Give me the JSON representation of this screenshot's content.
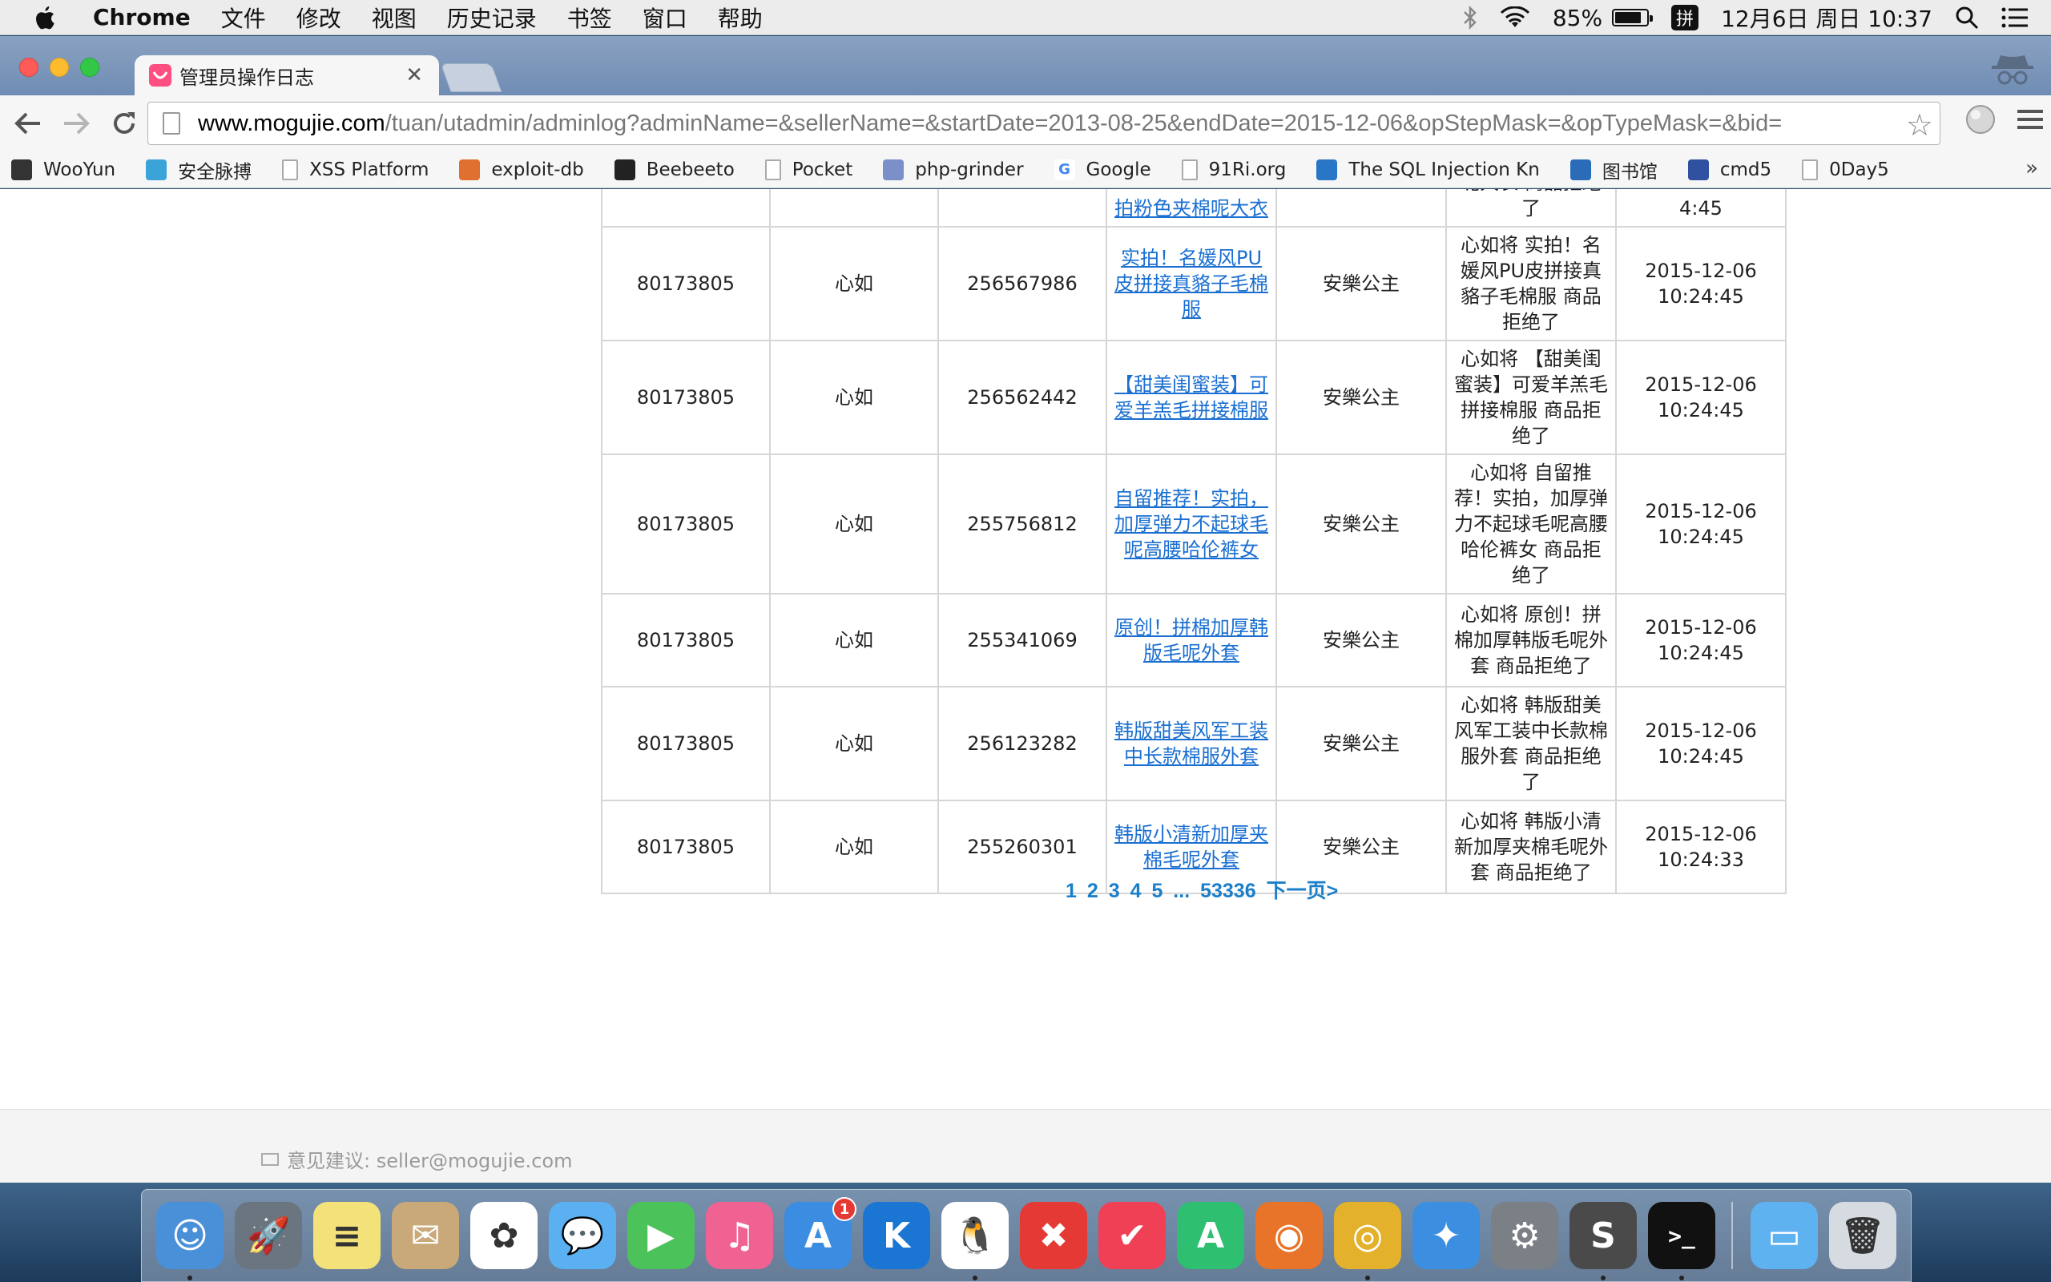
{
  "menubar": {
    "app": "Chrome",
    "items": [
      "文件",
      "修改",
      "视图",
      "历史记录",
      "书签",
      "窗口",
      "帮助"
    ],
    "battery_percent": "85%",
    "battery_level": 0.85,
    "ime": "拼",
    "datetime": "12月6日 周日 10:37"
  },
  "tab": {
    "title": "管理员操作日志"
  },
  "address": {
    "host": "www.mogujie.com",
    "path": "/tuan/utadmin/adminlog?adminName=&sellerName=&startDate=2013-08-25&endDate=2015-12-06&opStepMask=&opTypeMask=&bid="
  },
  "bookmarks": [
    {
      "label": "WooYun",
      "icon": "wooyun-icon",
      "color": "#333333"
    },
    {
      "label": "安全脉搏",
      "icon": "cloud-icon",
      "color": "#3aa3d8"
    },
    {
      "label": "XSS Platform",
      "icon": "page-icon",
      "color": "#ffffff"
    },
    {
      "label": "exploit-db",
      "icon": "bug-icon",
      "color": "#e07030"
    },
    {
      "label": "Beebeeto",
      "icon": "beebeeto-icon",
      "color": "#222222"
    },
    {
      "label": "Pocket",
      "icon": "page-icon",
      "color": "#ffffff"
    },
    {
      "label": "php-grinder",
      "icon": "grid-icon",
      "color": "#7b8fc9"
    },
    {
      "label": "Google",
      "icon": "google-icon",
      "color": "#ffffff"
    },
    {
      "label": "91Ri.org",
      "icon": "page-icon",
      "color": "#ffffff"
    },
    {
      "label": "The SQL Injection Kn",
      "icon": "sql-icon",
      "color": "#2a76c6"
    },
    {
      "label": "图书馆",
      "icon": "library-icon",
      "color": "#2a6cb8"
    },
    {
      "label": "cmd5",
      "icon": "cmd5-icon",
      "color": "#3050a0"
    },
    {
      "label": "0Day5",
      "icon": "page-icon",
      "color": "#ffffff"
    }
  ],
  "rows": [
    {
      "id": "80173805",
      "admin": "心如",
      "bid": "256567986",
      "product": "实拍！名媛风PU皮拼接真貉子毛棉服",
      "seller": "安樂公主",
      "action": "心如将 实拍！名媛风PU皮拼接真貉子毛棉服 商品拒绝了",
      "time": "2015-12-06 10:24:45"
    },
    {
      "id": "80173805",
      "admin": "心如",
      "bid": "256562442",
      "product": "【甜美闺蜜装】可爱羊羔毛拼接棉服",
      "seller": "安樂公主",
      "action": "心如将 【甜美闺蜜装】可爱羊羔毛拼接棉服 商品拒绝了",
      "time": "2015-12-06 10:24:45"
    },
    {
      "id": "80173805",
      "admin": "心如",
      "bid": "255756812",
      "product": "自留推荐！实拍，加厚弹力不起球毛呢高腰哈伦裤女",
      "seller": "安樂公主",
      "action": "心如将 自留推荐！实拍，加厚弹力不起球毛呢高腰哈伦裤女 商品拒绝了",
      "time": "2015-12-06 10:24:45"
    },
    {
      "id": "80173805",
      "admin": "心如",
      "bid": "255341069",
      "product": "原创！拼棉加厚韩版毛呢外套",
      "seller": "安樂公主",
      "action": "心如将 原创！拼棉加厚韩版毛呢外套 商品拒绝了",
      "time": "2015-12-06 10:24:45"
    },
    {
      "id": "80173805",
      "admin": "心如",
      "bid": "256123282",
      "product": "韩版甜美风军工装中长款棉服外套",
      "seller": "安樂公主",
      "action": "心如将 韩版甜美风军工装中长款棉服外套 商品拒绝了",
      "time": "2015-12-06 10:24:45"
    },
    {
      "id": "80173805",
      "admin": "心如",
      "bid": "255260301",
      "product": "韩版小清新加厚夹棉毛呢外套",
      "seller": "安樂公主",
      "action": "心如将 韩版小清新加厚夹棉毛呢外套 商品拒绝了",
      "time": "2015-12-06 10:24:33"
    }
  ],
  "partial_row": {
    "product": "拍粉色夹棉呢大衣",
    "action": "呢大衣 商品拒绝了",
    "time": "4:45"
  },
  "pager": {
    "pages": [
      "1",
      "2",
      "3",
      "4",
      "5"
    ],
    "ellipsis": "...",
    "last": "53336",
    "next": "下一页>"
  },
  "footer": {
    "feedback": "意见建议: seller@mogujie.com"
  },
  "dock": [
    {
      "name": "finder-icon",
      "color": "#4a90d9",
      "glyph": "☺",
      "running": true
    },
    {
      "name": "launchpad-icon",
      "color": "#6b7580",
      "glyph": "🚀",
      "running": false
    },
    {
      "name": "notes-icon",
      "color": "#f3e27a",
      "glyph": "≡",
      "running": false
    },
    {
      "name": "mail-stamp-icon",
      "color": "#c9a97a",
      "glyph": "✉",
      "running": false
    },
    {
      "name": "photos-icon",
      "color": "#ffffff",
      "glyph": "✿",
      "running": false
    },
    {
      "name": "messages-icon",
      "color": "#5ab0f0",
      "glyph": "💬",
      "running": false
    },
    {
      "name": "facetime-icon",
      "color": "#4cc35a",
      "glyph": "▶",
      "running": false
    },
    {
      "name": "itunes-icon",
      "color": "#f06292",
      "glyph": "♫",
      "running": false
    },
    {
      "name": "app-store-icon",
      "color": "#3a8de0",
      "glyph": "A",
      "running": false,
      "badge": "1"
    },
    {
      "name": "k-icon",
      "color": "#1a76d2",
      "glyph": "K",
      "running": false
    },
    {
      "name": "qq-icon",
      "color": "#ffffff",
      "glyph": "🐧",
      "running": true
    },
    {
      "name": "xmind-icon",
      "color": "#e53935",
      "glyph": "✖",
      "running": false
    },
    {
      "name": "pocket-icon",
      "color": "#ef4056",
      "glyph": "✔",
      "running": false
    },
    {
      "name": "a-app-icon",
      "color": "#2fbf71",
      "glyph": "A",
      "running": false
    },
    {
      "name": "firefox-icon",
      "color": "#e8742a",
      "glyph": "◉",
      "running": false
    },
    {
      "name": "chrome-icon",
      "color": "#e3b12b",
      "glyph": "◎",
      "running": true
    },
    {
      "name": "safari-icon",
      "color": "#3c8fe0",
      "glyph": "✦",
      "running": false
    },
    {
      "name": "system-prefs-icon",
      "color": "#7b7f86",
      "glyph": "⚙",
      "running": false
    },
    {
      "name": "sublime-icon",
      "color": "#4a4a4a",
      "glyph": "S",
      "running": true
    },
    {
      "name": "terminal-icon",
      "color": "#111111",
      "glyph": ">_",
      "running": true
    }
  ],
  "dock_right": [
    {
      "name": "folder-icon",
      "color": "#5fb2f0",
      "glyph": "▭"
    },
    {
      "name": "trash-icon",
      "color": "#d6dbe1",
      "glyph": "🗑"
    }
  ]
}
